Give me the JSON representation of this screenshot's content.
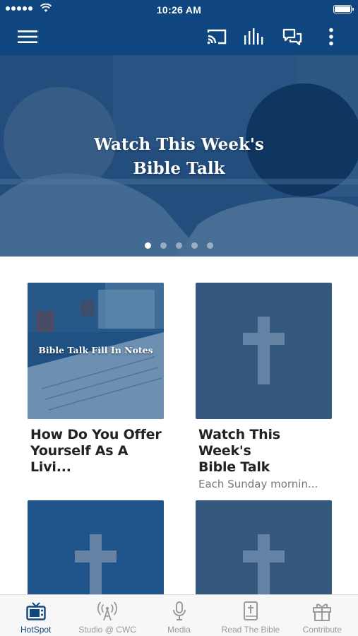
{
  "status_bar": {
    "time": "10:26 AM"
  },
  "toolbar": {
    "menu_icon": "hamburger-menu-icon",
    "actions": [
      "cast-icon",
      "audio-bars-icon",
      "chat-icon",
      "more-vertical-icon"
    ]
  },
  "hero": {
    "title": "Watch This Week's\nBible Talk",
    "slide_count": 5,
    "active_slide": 1
  },
  "cards": [
    {
      "thumb_text": "Bible Talk Fill In Notes",
      "title": "How Do You Offer\nYourself As A Livi...",
      "subtitle": ""
    },
    {
      "thumb_text": "",
      "title": "Watch This Week's\nBible Talk",
      "subtitle": "Each Sunday mornin..."
    },
    {
      "thumb_text": "",
      "title": "",
      "subtitle": ""
    },
    {
      "thumb_text": "",
      "title": "",
      "subtitle": ""
    }
  ],
  "tabs": [
    {
      "label": "HotSpot",
      "icon": "tv-icon",
      "active": true
    },
    {
      "label": "Studio @ CWC",
      "icon": "broadcast-tower-icon",
      "active": false
    },
    {
      "label": "Media",
      "icon": "microphone-icon",
      "active": false
    },
    {
      "label": "Read The Bible",
      "icon": "bible-icon",
      "active": false
    },
    {
      "label": "Contribute",
      "icon": "gift-icon",
      "active": false
    }
  ],
  "colors": {
    "brand": "#10467f",
    "tab_inactive": "#9a9a9a"
  }
}
